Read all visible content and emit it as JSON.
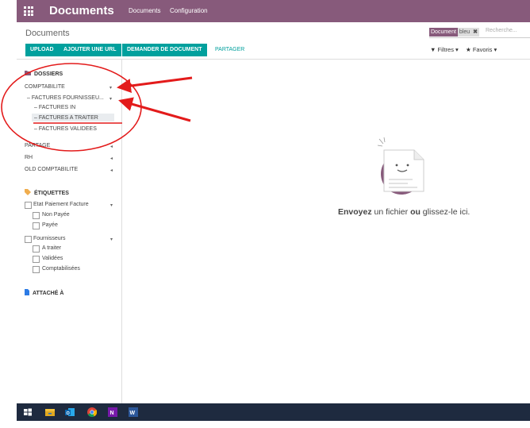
{
  "topbar": {
    "app_title": "Documents",
    "menu": [
      "Documents",
      "Configuration"
    ]
  },
  "breadcrumb": "Documents",
  "buttons": {
    "upload": "UPLOAD",
    "add_url": "AJOUTER UNE URL",
    "request": "DEMANDER DE DOCUMENT",
    "share": "PARTAGER"
  },
  "search": {
    "facet_label": "Document",
    "facet_value": "bleu",
    "facet_remove": "✖",
    "placeholder": "Recherche..."
  },
  "filters": {
    "filters_label": "Filtres",
    "favorites_label": "Favoris"
  },
  "sidebar": {
    "folders_title": "DOSSIERS",
    "folders": {
      "comptabilite": "COMPTABILITE",
      "factures_fournisseurs": "FACTURES FOURNISSEU...",
      "factures_in": "FACTURES IN",
      "factures_a_traiter": "FACTURES A TRAITER",
      "factures_validees": "FACTURES VALIDEES",
      "partage": "PARTAGE",
      "rh": "RH",
      "old_comptabilite": "OLD COMPTABILITE"
    },
    "tags_title": "ÉTIQUETTES",
    "tags": {
      "etat_paiement": "Etat Paiement Facture",
      "non_payee": "Non Payée",
      "payee": "Payée",
      "fournisseurs": "Fournisseurs",
      "a_traiter": "A traiter",
      "validees": "Validées",
      "comptabilisees": "Comptabilisées"
    },
    "attached_title": "ATTACHÉ À"
  },
  "empty_state": {
    "part1": "Envoyez",
    "part2": " un fichier ",
    "part3": "ou",
    "part4": " glissez-le ici."
  },
  "colors": {
    "brand": "#875a7b",
    "primary_button": "#00a09d",
    "annotation": "#e31b1b",
    "taskbar": "#1e2a3f"
  },
  "icons": [
    "apps-grid-icon",
    "folder-icon",
    "tag-icon",
    "file-icon",
    "windows-start-icon",
    "file-explorer-icon",
    "outlook-icon",
    "chrome-icon",
    "onenote-icon",
    "word-icon"
  ]
}
